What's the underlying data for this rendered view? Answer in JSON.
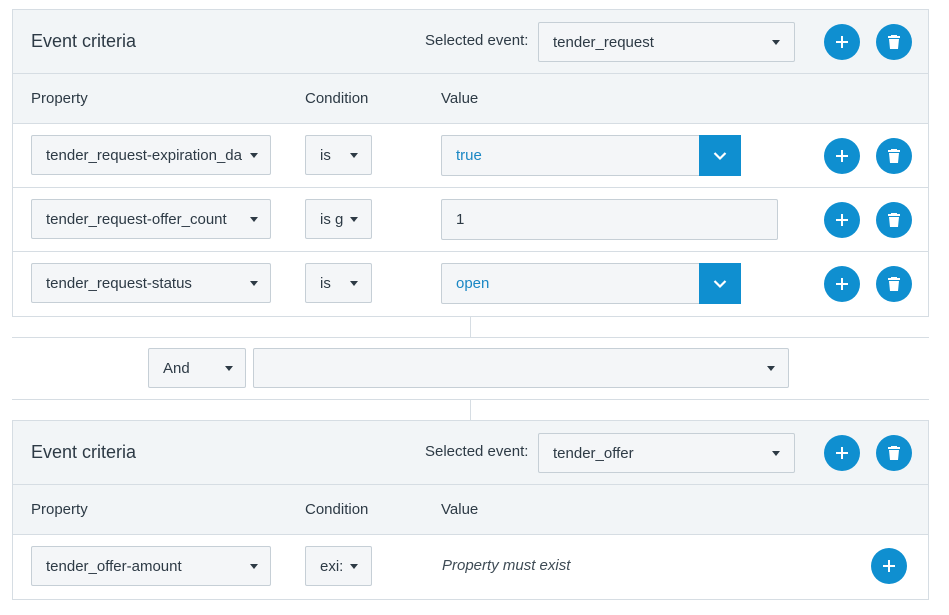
{
  "criteria": [
    {
      "title": "Event criteria",
      "selected_label": "Selected event:",
      "selected_event": "tender_request",
      "columns": {
        "property": "Property",
        "condition": "Condition",
        "value": "Value"
      },
      "rows": [
        {
          "property": "tender_request-expiration_da",
          "condition": "is",
          "value": "true"
        },
        {
          "property": "tender_request-offer_count",
          "condition": "is g",
          "value": "1"
        },
        {
          "property": "tender_request-status",
          "condition": "is",
          "value": "open"
        }
      ]
    },
    {
      "title": "Event criteria",
      "selected_label": "Selected event:",
      "selected_event": "tender_offer",
      "columns": {
        "property": "Property",
        "condition": "Condition",
        "value": "Value"
      },
      "rows": [
        {
          "property": "tender_offer-amount",
          "condition": "exi:",
          "value": "Property must exist"
        }
      ]
    }
  ],
  "join": {
    "operator": "And",
    "event": ""
  },
  "icons": {
    "add": "plus-icon",
    "delete": "trash-icon",
    "dropdown": "chevron-down-icon",
    "caret": "caret-down-icon"
  },
  "colors": {
    "accent": "#0f8fd0",
    "header_bg": "#f2f5f7",
    "border": "#d6dde3",
    "value_text": "#1a87c4"
  }
}
